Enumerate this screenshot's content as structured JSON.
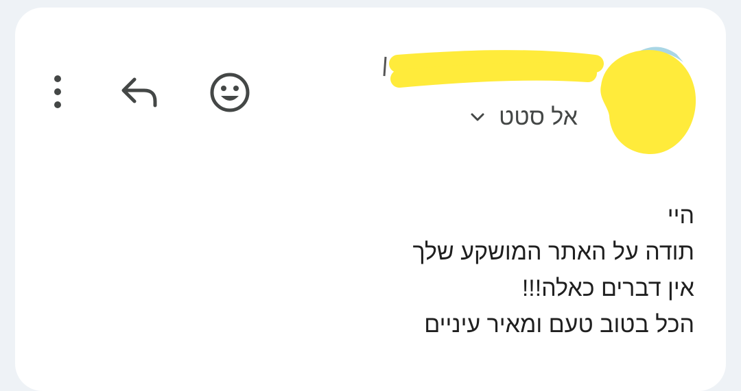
{
  "header": {
    "recipient_label": "אל סטט",
    "icons": [
      "more-vert-icon",
      "reply-icon",
      "emoji-icon",
      "expand-chevron-icon"
    ],
    "redaction_color": "#ffeb3b"
  },
  "message": {
    "lines": [
      "היי",
      "תודה על האתר המושקע שלך",
      "אין דברים כאלה!!!",
      "הכל בטוב טעם ומאיר עיניים"
    ]
  },
  "colors": {
    "background": "#eef2f6",
    "card": "#ffffff",
    "icon": "#444746",
    "text": "#1f1f1f"
  }
}
